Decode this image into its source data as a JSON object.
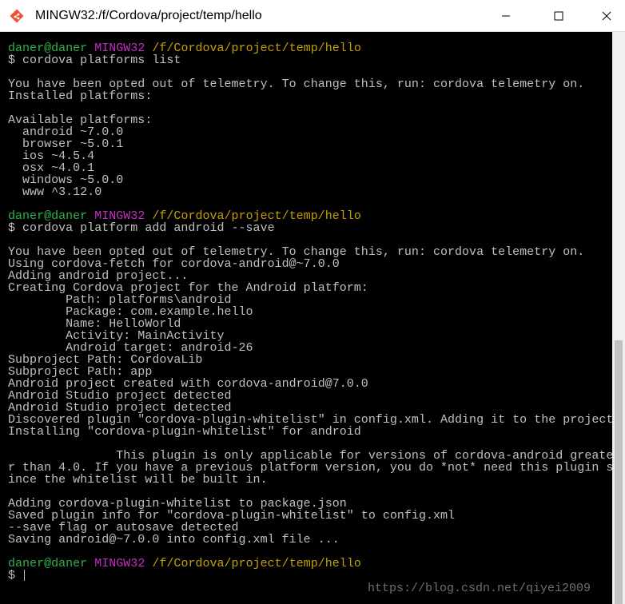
{
  "window": {
    "title": "MINGW32:/f/Cordova/project/temp/hello",
    "app_icon": "git-bash-diamond-icon",
    "controls": {
      "minimize_icon": "minimize-icon",
      "maximize_icon": "maximize-icon",
      "close_icon": "close-icon"
    }
  },
  "colors": {
    "background": "#000000",
    "text": "#c0c0c0",
    "prompt_user": "#2fb14b",
    "prompt_system": "#c02fc0",
    "prompt_path": "#c4a000"
  },
  "terminal": {
    "lines": [
      {
        "type": "prompt",
        "user": "daner@daner",
        "system": "MINGW32",
        "path": "/f/Cordova/project/temp/hello"
      },
      {
        "type": "text",
        "text": "$ cordova platforms list"
      },
      {
        "type": "text",
        "text": ""
      },
      {
        "type": "text",
        "text": "You have been opted out of telemetry. To change this, run: cordova telemetry on."
      },
      {
        "type": "text",
        "text": "Installed platforms:"
      },
      {
        "type": "text",
        "text": ""
      },
      {
        "type": "text",
        "text": "Available platforms:"
      },
      {
        "type": "text",
        "text": "  android ~7.0.0"
      },
      {
        "type": "text",
        "text": "  browser ~5.0.1"
      },
      {
        "type": "text",
        "text": "  ios ~4.5.4"
      },
      {
        "type": "text",
        "text": "  osx ~4.0.1"
      },
      {
        "type": "text",
        "text": "  windows ~5.0.0"
      },
      {
        "type": "text",
        "text": "  www ^3.12.0"
      },
      {
        "type": "text",
        "text": ""
      },
      {
        "type": "prompt",
        "user": "daner@daner",
        "system": "MINGW32",
        "path": "/f/Cordova/project/temp/hello"
      },
      {
        "type": "text",
        "text": "$ cordova platform add android --save"
      },
      {
        "type": "text",
        "text": ""
      },
      {
        "type": "text",
        "text": "You have been opted out of telemetry. To change this, run: cordova telemetry on."
      },
      {
        "type": "text",
        "text": "Using cordova-fetch for cordova-android@~7.0.0"
      },
      {
        "type": "text",
        "text": "Adding android project..."
      },
      {
        "type": "text",
        "text": "Creating Cordova project for the Android platform:"
      },
      {
        "type": "text",
        "text": "        Path: platforms\\android"
      },
      {
        "type": "text",
        "text": "        Package: com.example.hello"
      },
      {
        "type": "text",
        "text": "        Name: HelloWorld"
      },
      {
        "type": "text",
        "text": "        Activity: MainActivity"
      },
      {
        "type": "text",
        "text": "        Android target: android-26"
      },
      {
        "type": "text",
        "text": "Subproject Path: CordovaLib"
      },
      {
        "type": "text",
        "text": "Subproject Path: app"
      },
      {
        "type": "text",
        "text": "Android project created with cordova-android@7.0.0"
      },
      {
        "type": "text",
        "text": "Android Studio project detected"
      },
      {
        "type": "text",
        "text": "Android Studio project detected"
      },
      {
        "type": "text",
        "text": "Discovered plugin \"cordova-plugin-whitelist\" in config.xml. Adding it to the project"
      },
      {
        "type": "text",
        "text": "Installing \"cordova-plugin-whitelist\" for android"
      },
      {
        "type": "text",
        "text": ""
      },
      {
        "type": "text",
        "text": "               This plugin is only applicable for versions of cordova-android greate"
      },
      {
        "type": "text",
        "text": "r than 4.0. If you have a previous platform version, you do *not* need this plugin s"
      },
      {
        "type": "text",
        "text": "ince the whitelist will be built in."
      },
      {
        "type": "text",
        "text": ""
      },
      {
        "type": "text",
        "text": "Adding cordova-plugin-whitelist to package.json"
      },
      {
        "type": "text",
        "text": "Saved plugin info for \"cordova-plugin-whitelist\" to config.xml"
      },
      {
        "type": "text",
        "text": "--save flag or autosave detected"
      },
      {
        "type": "text",
        "text": "Saving android@~7.0.0 into config.xml file ..."
      },
      {
        "type": "text",
        "text": ""
      },
      {
        "type": "prompt",
        "user": "daner@daner",
        "system": "MINGW32",
        "path": "/f/Cordova/project/temp/hello"
      },
      {
        "type": "input",
        "text": "$ "
      }
    ]
  },
  "watermark": "https://blog.csdn.net/qiyei2009"
}
